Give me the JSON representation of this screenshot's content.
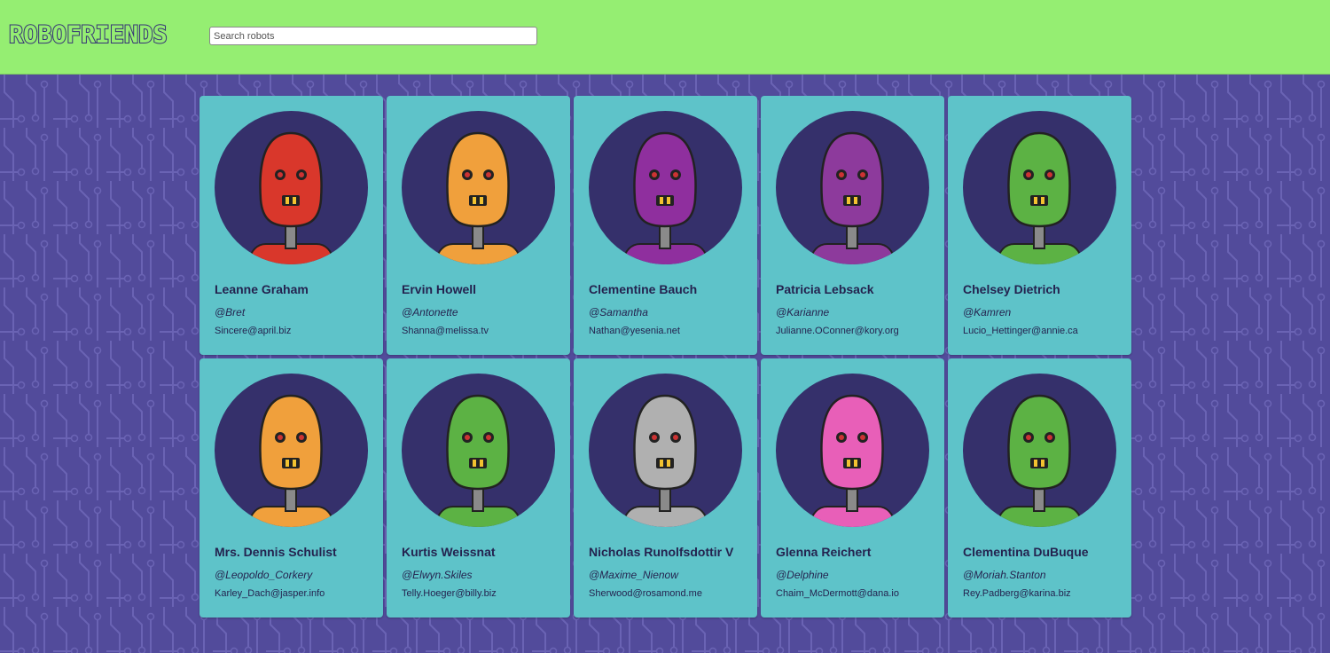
{
  "header": {
    "logo_text": "ROBOFRIENDS",
    "search_placeholder": "Search robots",
    "background": "#95ee72"
  },
  "colors": {
    "page_background": "#524b9b",
    "card_background": "#5ec3c9",
    "avatar_background": "#35306b",
    "text": "#24234f"
  },
  "robots": [
    {
      "name": "Leanne Graham",
      "username": "@Bret",
      "email": "Sincere@april.biz",
      "color": "#d9372b",
      "icon": "red-robot-avatar"
    },
    {
      "name": "Ervin Howell",
      "username": "@Antonette",
      "email": "Shanna@melissa.tv",
      "color": "#f0a03c",
      "icon": "orange-robot-avatar"
    },
    {
      "name": "Clementine Bauch",
      "username": "@Samantha",
      "email": "Nathan@yesenia.net",
      "color": "#8f2f9e",
      "icon": "purple-robot-avatar"
    },
    {
      "name": "Patricia Lebsack",
      "username": "@Karianne",
      "email": "Julianne.OConner@kory.org",
      "color": "#8d3a9c",
      "icon": "purple-robot-avatar"
    },
    {
      "name": "Chelsey Dietrich",
      "username": "@Kamren",
      "email": "Lucio_Hettinger@annie.ca",
      "color": "#5cb244",
      "icon": "green-robot-avatar"
    },
    {
      "name": "Mrs. Dennis Schulist",
      "username": "@Leopoldo_Corkery",
      "email": "Karley_Dach@jasper.info",
      "color": "#f0a03c",
      "icon": "orange-robot-avatar"
    },
    {
      "name": "Kurtis Weissnat",
      "username": "@Elwyn.Skiles",
      "email": "Telly.Hoeger@billy.biz",
      "color": "#5cb244",
      "icon": "green-robot-avatar"
    },
    {
      "name": "Nicholas Runolfsdottir V",
      "username": "@Maxime_Nienow",
      "email": "Sherwood@rosamond.me",
      "color": "#b0b0b0",
      "icon": "gray-robot-avatar"
    },
    {
      "name": "Glenna Reichert",
      "username": "@Delphine",
      "email": "Chaim_McDermott@dana.io",
      "color": "#e85fb8",
      "icon": "pink-robot-avatar"
    },
    {
      "name": "Clementina DuBuque",
      "username": "@Moriah.Stanton",
      "email": "Rey.Padberg@karina.biz",
      "color": "#5cb244",
      "icon": "green-robot-avatar"
    }
  ]
}
